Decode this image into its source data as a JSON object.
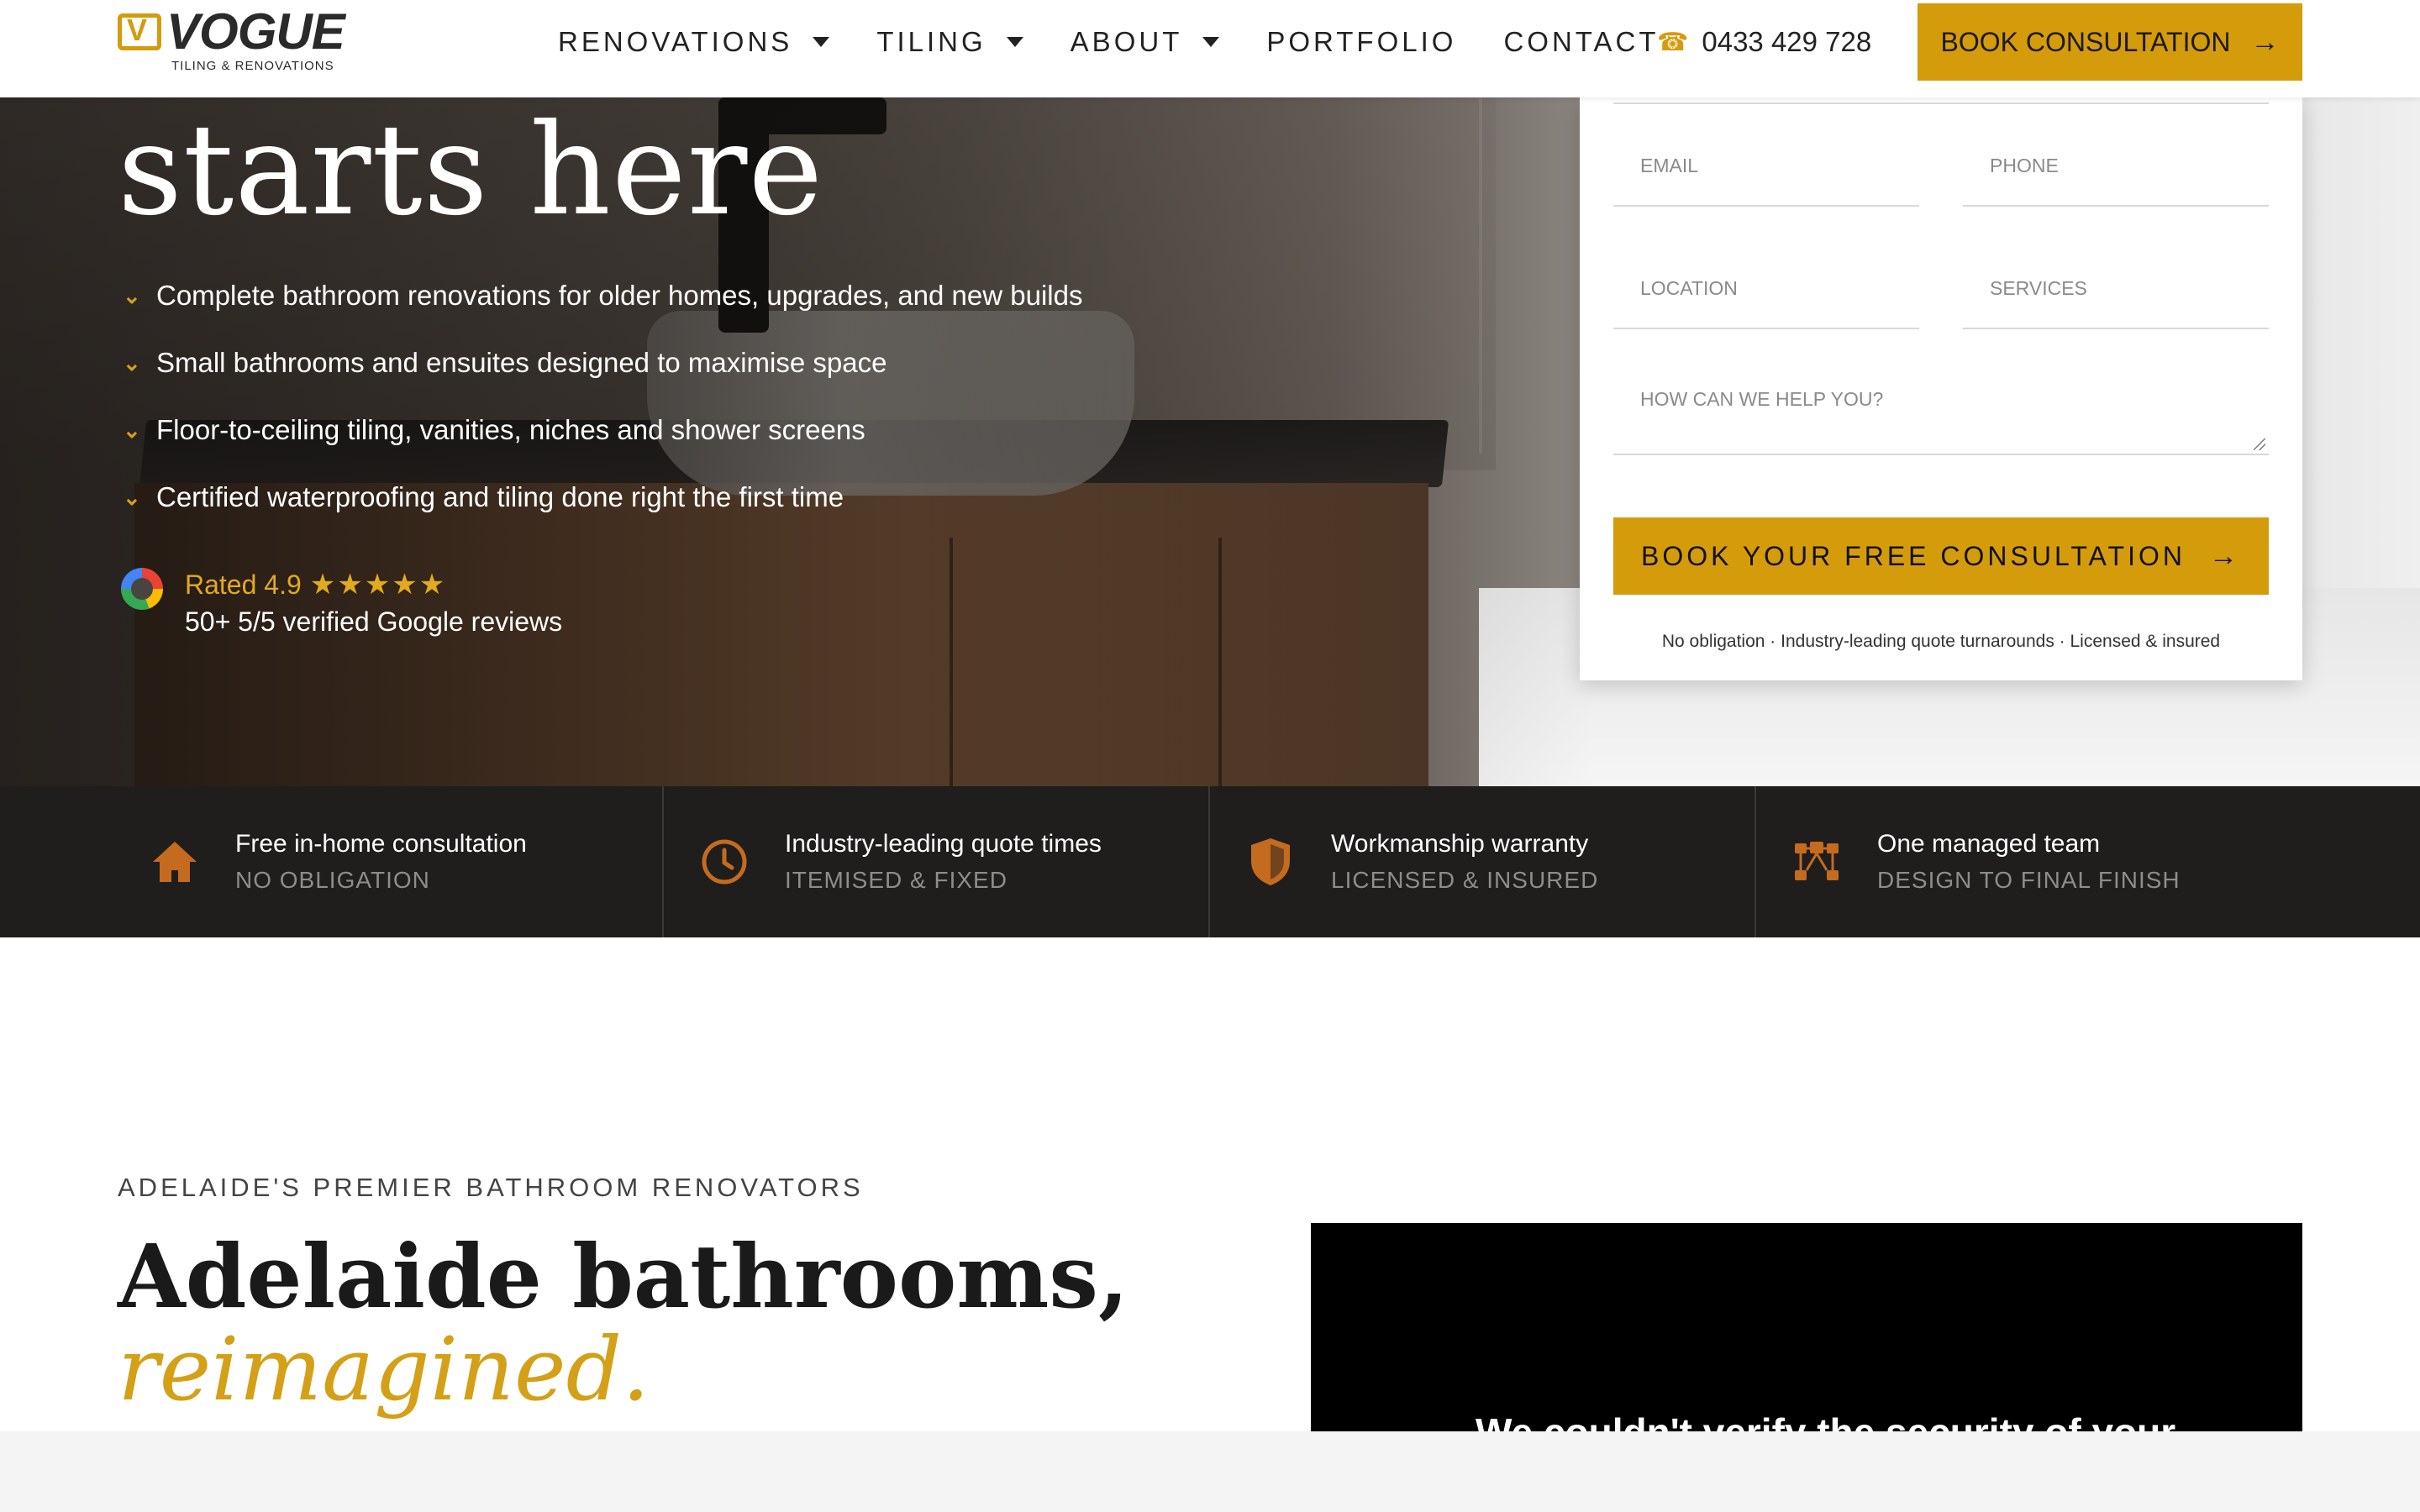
{
  "nav": {
    "logo_word": "VOGUE",
    "logo_sub": "TILING & RENOVATIONS",
    "items": [
      {
        "label": "RENOVATIONS",
        "dropdown": true
      },
      {
        "label": "TILING",
        "dropdown": true
      },
      {
        "label": "ABOUT",
        "dropdown": true
      },
      {
        "label": "PORTFOLIO",
        "dropdown": false
      },
      {
        "label": "CONTACT",
        "dropdown": false
      }
    ],
    "phone": "0433 429 728",
    "cta": "BOOK CONSULTATION"
  },
  "hero": {
    "title": "starts here",
    "bullets": [
      "Complete bathroom renovations for older homes, upgrades, and new builds",
      "Small bathrooms and ensuites designed to maximise space",
      "Floor-to-ceiling tiling, vanities, niches and shower screens",
      "Certified waterproofing and tiling done right the first time"
    ],
    "rating_label": "Rated 4.9",
    "stars": "★★★★★",
    "reviews": "50+ 5/5 verified Google reviews"
  },
  "form": {
    "email_placeholder": "EMAIL",
    "phone_placeholder": "PHONE",
    "location_placeholder": "LOCATION",
    "services_placeholder": "SERVICES",
    "message_placeholder": "HOW CAN WE HELP YOU?",
    "submit": "BOOK YOUR FREE CONSULTATION",
    "note": "No obligation · Industry-leading quote turnarounds · Licensed & insured"
  },
  "features": [
    {
      "icon": "home-icon",
      "title": "Free in-home consultation",
      "sub": "NO OBLIGATION"
    },
    {
      "icon": "clock-icon",
      "title": "Industry-leading quote times",
      "sub": "ITEMISED & FIXED"
    },
    {
      "icon": "shield-icon",
      "title": "Workmanship warranty",
      "sub": "LICENSED & INSURED"
    },
    {
      "icon": "team-icon",
      "title": "One managed team",
      "sub": "DESIGN TO FINAL FINISH"
    }
  ],
  "intro": {
    "eyebrow": "ADELAIDE'S PREMIER BATHROOM RENOVATORS",
    "title": "Adelaide bathrooms,",
    "accent": "reimagined."
  },
  "video": {
    "message": "We couldn't verify the security of your"
  },
  "colors": {
    "accent": "#d49b0b",
    "dark": "#1f1e1d",
    "icon": "#c46b1f"
  }
}
